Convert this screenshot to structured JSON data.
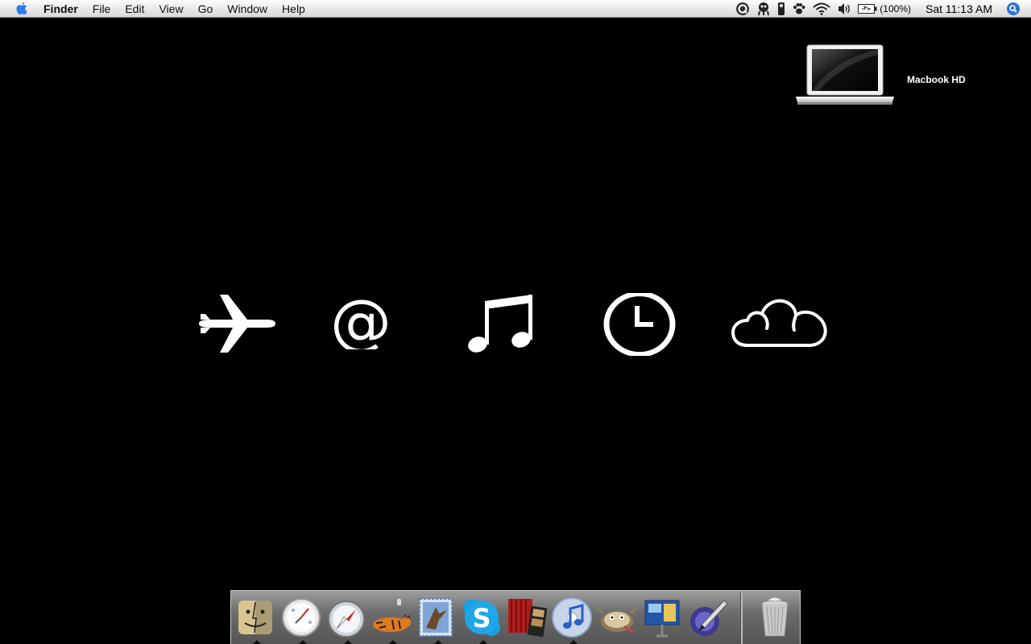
{
  "menubar": {
    "app_name": "Finder",
    "menus": [
      "File",
      "Edit",
      "View",
      "Go",
      "Window",
      "Help"
    ],
    "status_icons": [
      "quicksilver-icon",
      "alien-icon",
      "remote-icon",
      "paw-icon",
      "wifi-icon",
      "volume-icon",
      "battery-icon"
    ],
    "battery_text": "(100%)",
    "clock": "Sat 11:13 AM"
  },
  "desktop": {
    "hd_label": "Macbook HD",
    "glyphs": [
      "airplane-icon",
      "at-sign-icon",
      "music-note-icon",
      "clock-icon",
      "cloud-icon"
    ],
    "glyph_color": "#ffffff"
  },
  "dock": {
    "items": [
      {
        "name": "finder",
        "running": true
      },
      {
        "name": "dashboard",
        "running": true
      },
      {
        "name": "safari",
        "running": true
      },
      {
        "name": "cat-app",
        "running": true
      },
      {
        "name": "mail",
        "running": true
      },
      {
        "name": "skype",
        "running": true
      },
      {
        "name": "photo-booth",
        "running": false
      },
      {
        "name": "itunes",
        "running": true
      },
      {
        "name": "gimp",
        "running": false
      },
      {
        "name": "keynote",
        "running": false
      },
      {
        "name": "pen-app",
        "running": false
      }
    ],
    "trash": "trash"
  }
}
